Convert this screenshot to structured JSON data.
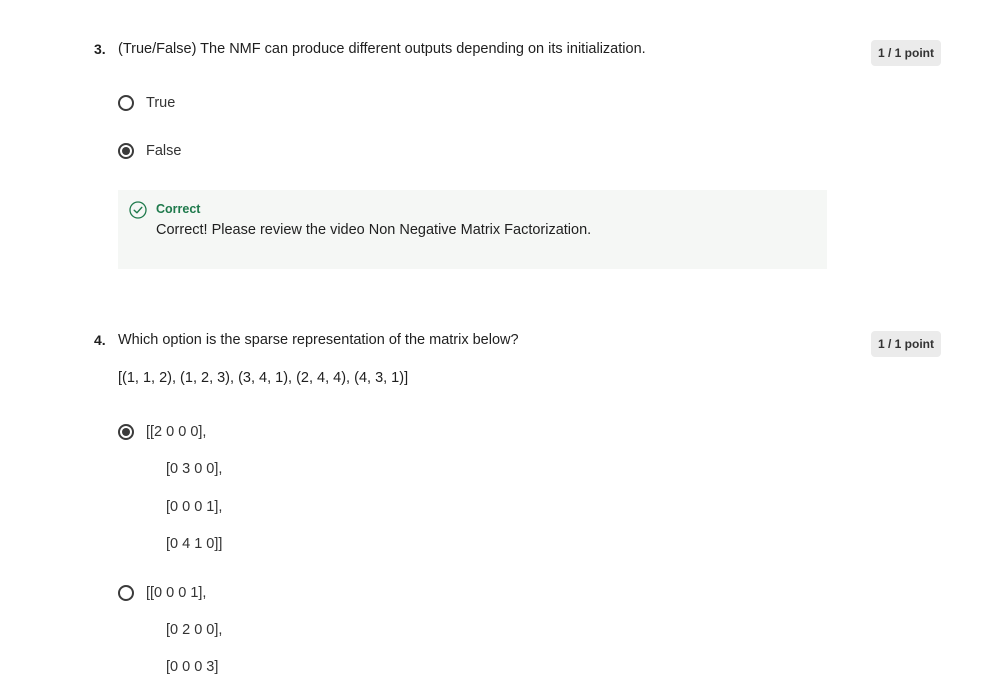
{
  "questions": [
    {
      "number": "3.",
      "text": "(True/False) The NMF can produce different outputs depending on its initialization.",
      "points": "1 / 1 point",
      "options": [
        {
          "label": "True",
          "selected": false
        },
        {
          "label": "False",
          "selected": true
        }
      ],
      "feedback": {
        "status": "Correct",
        "message": "Correct! Please review the video Non Negative Matrix Factorization.",
        "icon": "check-circle-icon",
        "color": "#1f7a4c"
      }
    },
    {
      "number": "4.",
      "text": "Which option is the sparse representation of the matrix below?",
      "points": "1 / 1 point",
      "subtext": "[(1, 1, 2), (1, 2, 3), (3, 4, 1), (2, 4, 4), (4, 3, 1)]",
      "options": [
        {
          "lines": [
            "[[2 0 0 0],",
            "[0 3 0 0],",
            "[0 0 0 1],",
            "[0 4 1 0]]"
          ],
          "selected": true
        },
        {
          "lines": [
            "[[0 0 0 1],",
            "[0 2 0 0],",
            "[0 0 0 3]"
          ],
          "selected": false
        }
      ]
    }
  ]
}
